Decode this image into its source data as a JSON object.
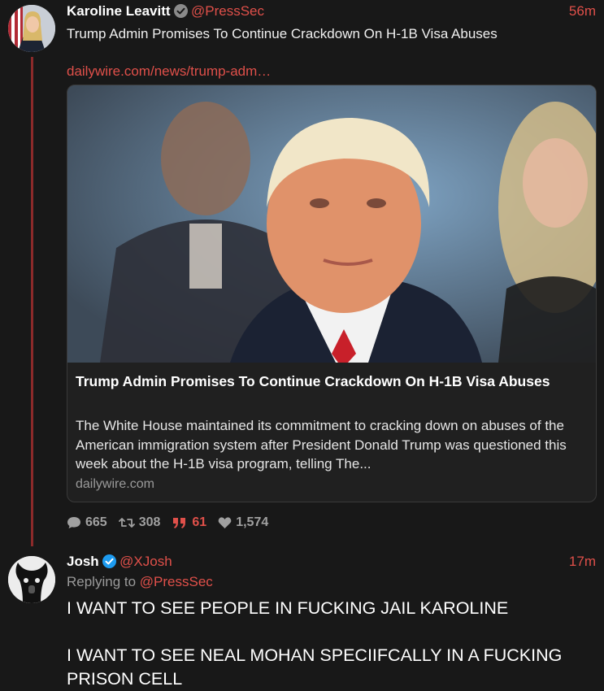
{
  "post1": {
    "author_name": "Karoline Leavitt",
    "handle": "@PressSec",
    "time": "56m",
    "text": "Trump Admin Promises To Continue Crackdown On H-1B Visa Abuses",
    "link": "dailywire.com/news/trump-adm…",
    "card": {
      "title": "Trump Admin Promises To Continue Crackdown On H-1B Visa Abuses",
      "description": "The White House maintained its commitment to cracking down on abuses of the American immigration system after President Donald Trump was questioned this week about the H-1B visa program, telling The...",
      "domain": "dailywire.com"
    },
    "stats": {
      "replies": "665",
      "reposts": "308",
      "quotes": "61",
      "likes": "1,574"
    }
  },
  "post2": {
    "author_name": "Josh",
    "handle": "@XJosh",
    "time": "17m",
    "replying_label": "Replying to",
    "replying_handle": "@PressSec",
    "text": "I WANT TO SEE PEOPLE IN FUCKING JAIL KAROLINE\n\nI WANT TO SEE NEAL MOHAN SPECIIFCALLY IN A FUCKING PRISON CELL"
  },
  "colors": {
    "background": "#181818",
    "accent": "#e0504a",
    "thread_line": "#8b2a2a",
    "verified_gray": "#8a8a8a",
    "verified_blue": "#1d9bf0"
  }
}
